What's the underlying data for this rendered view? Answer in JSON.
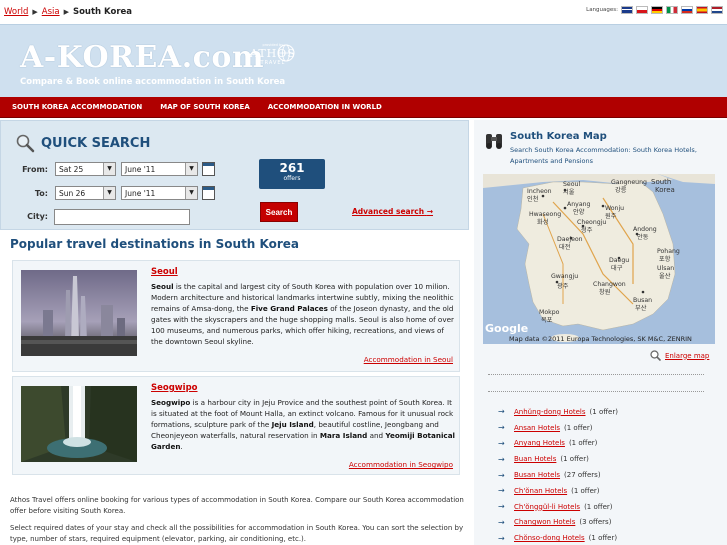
{
  "breadcrumb": {
    "world": "World",
    "asia": "Asia",
    "current": "South Korea"
  },
  "languages": {
    "label": "Languages:"
  },
  "header": {
    "logo": "A-KOREA.com",
    "provided_by": "provided by",
    "athos": "ATHOS",
    "travel": "TRAVEL",
    "tagline": "Compare & Book online accommodation in South Korea"
  },
  "nav": [
    "SOUTH KOREA ACCOMMODATION",
    "MAP OF SOUTH KOREA",
    "ACCOMMODATION IN WORLD"
  ],
  "quick_search": {
    "title": "QUICK SEARCH",
    "from_label": "From:",
    "to_label": "To:",
    "city_label": "City:",
    "from_day": "Sat 25",
    "from_month": "June '11",
    "to_day": "Sun 26",
    "to_month": "June '11",
    "offers_count": "261",
    "offers_label": "offers",
    "search_button": "Search",
    "advanced": "Advanced search"
  },
  "popular": {
    "title": "Popular travel destinations in South Korea",
    "destinations": [
      {
        "name": "Seoul",
        "bold": "Seoul",
        "text1": " is the capital and largest city of South Korea with population over 10 milion. Modern architecture and historical landmarks intertwine subtly, mixing the neolithic remains of Amsa-dong, the ",
        "bold2": "Five Grand Palaces",
        "text2": " of the Joseon dynasty, and the old gates with the skyscrapers and the huge shopping malls. Seoul is also home of over 100 museums, and numerous parks, which offer hiking, recreations, and views of the downtown Seoul skyline.",
        "more": "Accommodation in Seoul"
      },
      {
        "name": "Seogwipo",
        "bold": "Seogwipo",
        "text1": " is a harbour city in Jeju Provice and the southest point of South Korea. It is situated at the foot of Mount Halla, an extinct volcano. Famous for it unusual rock formations, sculpture park of the ",
        "bold2": "Jeju Island",
        "text2": ", beautiful costline, Jeongbang and Cheonjeyeon waterfalls, natural reservation in ",
        "bold3": "Mara Island",
        "text3": " and ",
        "bold4": "Yeomiji Botanical Garden",
        "text4": ".",
        "more": "Accommodation in Seogwipo"
      }
    ]
  },
  "about": {
    "p1": "Athos Travel offers online booking for various types of accommodation in South Korea. Compare our South Korea accommodation offer before visiting South Korea.",
    "p2": "Select required dates of your stay and check all the possibilities for accommodation in South Korea. You can sort the selection by type, number of stars, required equipment (elevator, parking, air conditioning, etc.)."
  },
  "map_box": {
    "title": "South Korea Map",
    "subtitle": "Search South Korea Accommodation: South Korea Hotels, Apartments and Pensions",
    "enlarge": "Enlarge map",
    "google": "Google",
    "attribution": "Map data ©2011 Europa Technologies, SK M&C, ZENRIN",
    "places": [
      {
        "name": "Seoul",
        "local": "서울"
      },
      {
        "name": "Incheon",
        "local": "인천"
      },
      {
        "name": "Gangneung",
        "local": "강릉"
      },
      {
        "name": "South Korea",
        "local": ""
      },
      {
        "name": "Anyang",
        "local": "안양"
      },
      {
        "name": "Wonju",
        "local": "원주"
      },
      {
        "name": "Hwaseong",
        "local": "화성"
      },
      {
        "name": "Cheongju",
        "local": "청주"
      },
      {
        "name": "Andong",
        "local": "안동"
      },
      {
        "name": "Daejeon",
        "local": "대전"
      },
      {
        "name": "Pohang",
        "local": "포항"
      },
      {
        "name": "Daegu",
        "local": "대구"
      },
      {
        "name": "Ulsan",
        "local": "울산"
      },
      {
        "name": "Gwangju",
        "local": "광주"
      },
      {
        "name": "Changwon",
        "local": "창원"
      },
      {
        "name": "Busan",
        "local": "부산"
      },
      {
        "name": "Mokpo",
        "local": "목포"
      }
    ]
  },
  "hotels": [
    {
      "name": "Anhŭng-dong Hotels",
      "count": "(1 offer)"
    },
    {
      "name": "Ansan Hotels",
      "count": "(1 offer)"
    },
    {
      "name": "Anyang Hotels",
      "count": "(1 offer)"
    },
    {
      "name": "Buan Hotels",
      "count": "(1 offer)"
    },
    {
      "name": "Busan Hotels",
      "count": "(27 offers)"
    },
    {
      "name": "Ch'ŏnan Hotels",
      "count": "(1 offer)"
    },
    {
      "name": "Ch'ŏnggŭl-li Hotels",
      "count": "(1 offer)"
    },
    {
      "name": "Changwon Hotels",
      "count": "(3 offers)"
    },
    {
      "name": "Chŏnso-dong Hotels",
      "count": "(1 offer)"
    }
  ],
  "colors": {
    "brand_red": "#b00000",
    "header_blue": "#cfe0ef",
    "title_blue": "#1f4f7c"
  }
}
